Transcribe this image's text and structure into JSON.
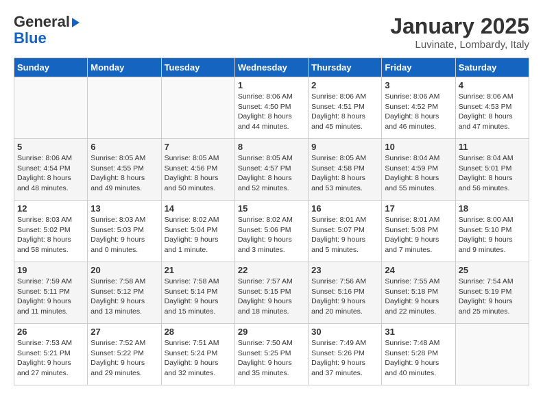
{
  "header": {
    "logo_line1": "General",
    "logo_line2": "Blue",
    "month_title": "January 2025",
    "location": "Luvinate, Lombardy, Italy"
  },
  "days_of_week": [
    "Sunday",
    "Monday",
    "Tuesday",
    "Wednesday",
    "Thursday",
    "Friday",
    "Saturday"
  ],
  "weeks": [
    [
      {
        "day": "",
        "info": ""
      },
      {
        "day": "",
        "info": ""
      },
      {
        "day": "",
        "info": ""
      },
      {
        "day": "1",
        "info": "Sunrise: 8:06 AM\nSunset: 4:50 PM\nDaylight: 8 hours\nand 44 minutes."
      },
      {
        "day": "2",
        "info": "Sunrise: 8:06 AM\nSunset: 4:51 PM\nDaylight: 8 hours\nand 45 minutes."
      },
      {
        "day": "3",
        "info": "Sunrise: 8:06 AM\nSunset: 4:52 PM\nDaylight: 8 hours\nand 46 minutes."
      },
      {
        "day": "4",
        "info": "Sunrise: 8:06 AM\nSunset: 4:53 PM\nDaylight: 8 hours\nand 47 minutes."
      }
    ],
    [
      {
        "day": "5",
        "info": "Sunrise: 8:06 AM\nSunset: 4:54 PM\nDaylight: 8 hours\nand 48 minutes."
      },
      {
        "day": "6",
        "info": "Sunrise: 8:05 AM\nSunset: 4:55 PM\nDaylight: 8 hours\nand 49 minutes."
      },
      {
        "day": "7",
        "info": "Sunrise: 8:05 AM\nSunset: 4:56 PM\nDaylight: 8 hours\nand 50 minutes."
      },
      {
        "day": "8",
        "info": "Sunrise: 8:05 AM\nSunset: 4:57 PM\nDaylight: 8 hours\nand 52 minutes."
      },
      {
        "day": "9",
        "info": "Sunrise: 8:05 AM\nSunset: 4:58 PM\nDaylight: 8 hours\nand 53 minutes."
      },
      {
        "day": "10",
        "info": "Sunrise: 8:04 AM\nSunset: 4:59 PM\nDaylight: 8 hours\nand 55 minutes."
      },
      {
        "day": "11",
        "info": "Sunrise: 8:04 AM\nSunset: 5:01 PM\nDaylight: 8 hours\nand 56 minutes."
      }
    ],
    [
      {
        "day": "12",
        "info": "Sunrise: 8:03 AM\nSunset: 5:02 PM\nDaylight: 8 hours\nand 58 minutes."
      },
      {
        "day": "13",
        "info": "Sunrise: 8:03 AM\nSunset: 5:03 PM\nDaylight: 9 hours\nand 0 minutes."
      },
      {
        "day": "14",
        "info": "Sunrise: 8:02 AM\nSunset: 5:04 PM\nDaylight: 9 hours\nand 1 minute."
      },
      {
        "day": "15",
        "info": "Sunrise: 8:02 AM\nSunset: 5:06 PM\nDaylight: 9 hours\nand 3 minutes."
      },
      {
        "day": "16",
        "info": "Sunrise: 8:01 AM\nSunset: 5:07 PM\nDaylight: 9 hours\nand 5 minutes."
      },
      {
        "day": "17",
        "info": "Sunrise: 8:01 AM\nSunset: 5:08 PM\nDaylight: 9 hours\nand 7 minutes."
      },
      {
        "day": "18",
        "info": "Sunrise: 8:00 AM\nSunset: 5:10 PM\nDaylight: 9 hours\nand 9 minutes."
      }
    ],
    [
      {
        "day": "19",
        "info": "Sunrise: 7:59 AM\nSunset: 5:11 PM\nDaylight: 9 hours\nand 11 minutes."
      },
      {
        "day": "20",
        "info": "Sunrise: 7:58 AM\nSunset: 5:12 PM\nDaylight: 9 hours\nand 13 minutes."
      },
      {
        "day": "21",
        "info": "Sunrise: 7:58 AM\nSunset: 5:14 PM\nDaylight: 9 hours\nand 15 minutes."
      },
      {
        "day": "22",
        "info": "Sunrise: 7:57 AM\nSunset: 5:15 PM\nDaylight: 9 hours\nand 18 minutes."
      },
      {
        "day": "23",
        "info": "Sunrise: 7:56 AM\nSunset: 5:16 PM\nDaylight: 9 hours\nand 20 minutes."
      },
      {
        "day": "24",
        "info": "Sunrise: 7:55 AM\nSunset: 5:18 PM\nDaylight: 9 hours\nand 22 minutes."
      },
      {
        "day": "25",
        "info": "Sunrise: 7:54 AM\nSunset: 5:19 PM\nDaylight: 9 hours\nand 25 minutes."
      }
    ],
    [
      {
        "day": "26",
        "info": "Sunrise: 7:53 AM\nSunset: 5:21 PM\nDaylight: 9 hours\nand 27 minutes."
      },
      {
        "day": "27",
        "info": "Sunrise: 7:52 AM\nSunset: 5:22 PM\nDaylight: 9 hours\nand 29 minutes."
      },
      {
        "day": "28",
        "info": "Sunrise: 7:51 AM\nSunset: 5:24 PM\nDaylight: 9 hours\nand 32 minutes."
      },
      {
        "day": "29",
        "info": "Sunrise: 7:50 AM\nSunset: 5:25 PM\nDaylight: 9 hours\nand 35 minutes."
      },
      {
        "day": "30",
        "info": "Sunrise: 7:49 AM\nSunset: 5:26 PM\nDaylight: 9 hours\nand 37 minutes."
      },
      {
        "day": "31",
        "info": "Sunrise: 7:48 AM\nSunset: 5:28 PM\nDaylight: 9 hours\nand 40 minutes."
      },
      {
        "day": "",
        "info": ""
      }
    ]
  ]
}
